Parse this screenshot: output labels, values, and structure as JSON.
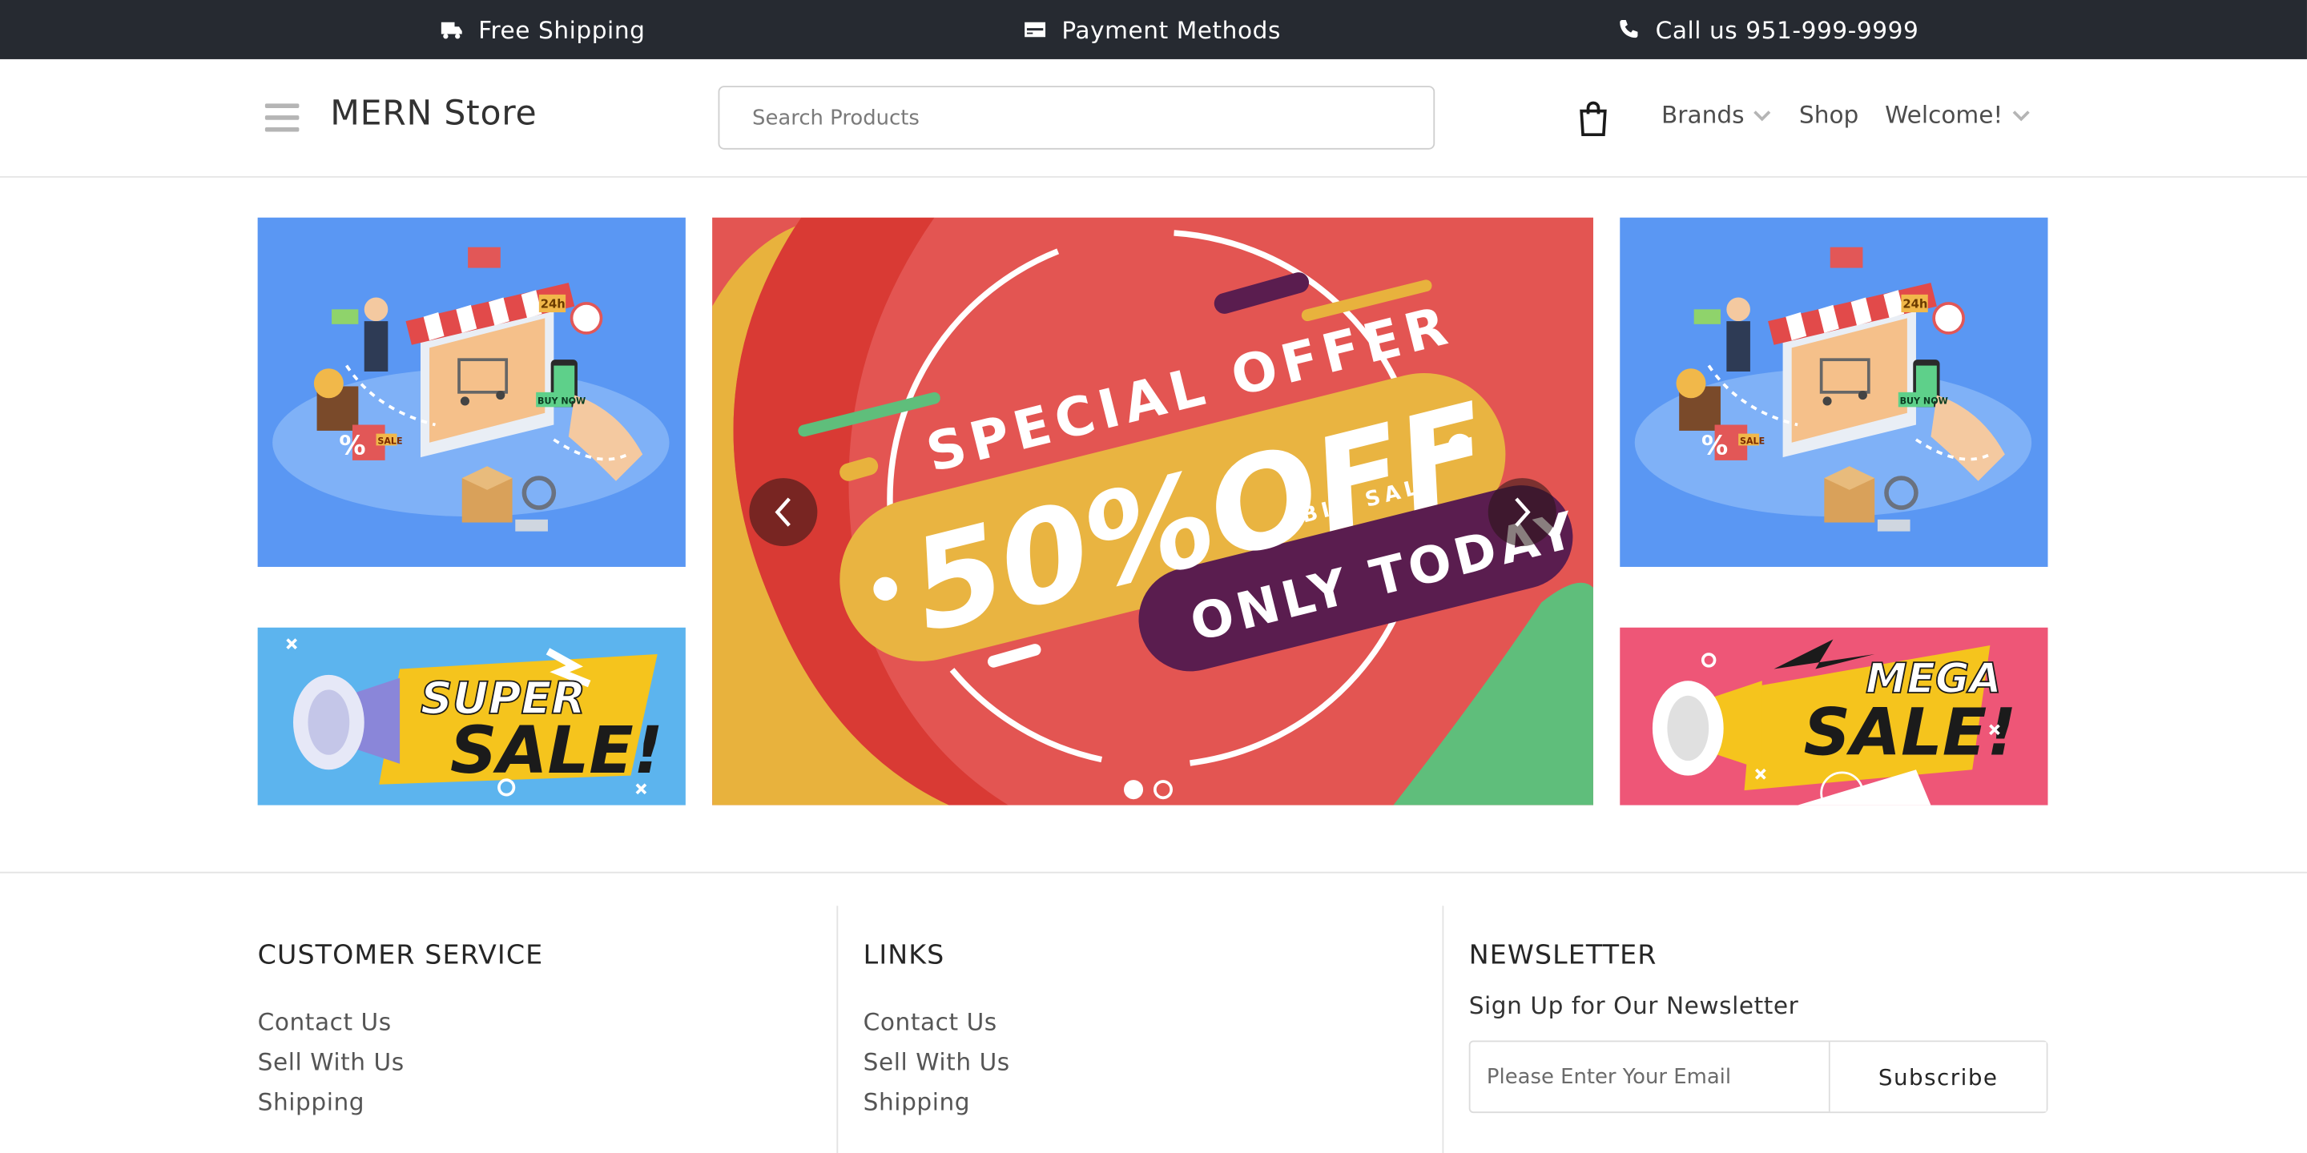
{
  "topbar": {
    "shipping": "Free Shipping",
    "payment": "Payment Methods",
    "phone": "Call us 951-999-9999"
  },
  "header": {
    "logo": "MERN Store",
    "search_placeholder": "Search Products",
    "nav": [
      "Brands",
      "Shop",
      "Welcome!"
    ]
  },
  "banners": {
    "carousel": {
      "special_offer": "SPECIAL OFFER",
      "discount": "50%OFF",
      "big_sale": "BIG SALE",
      "only_today": "ONLY TODAY",
      "slides": 2,
      "active_slide": 1
    },
    "super_sale": [
      "SUPER",
      "SALE!"
    ],
    "mega_sale": [
      "MEGA",
      "SALE!"
    ],
    "shop_badges": [
      "24h",
      "BUY NOW",
      "SALE",
      "%"
    ]
  },
  "colors": {
    "topbar": "#262a31",
    "carousel_bg": "#e35552",
    "offer_yellow": "#e9b441",
    "offer_purple": "#5a1d4f",
    "blue_banner": "#5a97f3",
    "pink_banner": "#ee5677"
  },
  "footer": {
    "customer_service": {
      "title": "CUSTOMER SERVICE",
      "links": [
        "Contact Us",
        "Sell With Us",
        "Shipping"
      ]
    },
    "links": {
      "title": "LINKS",
      "links": [
        "Contact Us",
        "Sell With Us",
        "Shipping"
      ]
    },
    "newsletter": {
      "title": "NEWSLETTER",
      "subtitle": "Sign Up for Our Newsletter",
      "placeholder": "Please Enter Your Email",
      "button": "Subscribe"
    }
  },
  "icons": [
    "truck-icon",
    "credit-card-icon",
    "phone-icon",
    "hamburger-icon",
    "shopping-bag-icon",
    "chevron-down-icon",
    "chevron-left-icon",
    "chevron-right-icon"
  ]
}
